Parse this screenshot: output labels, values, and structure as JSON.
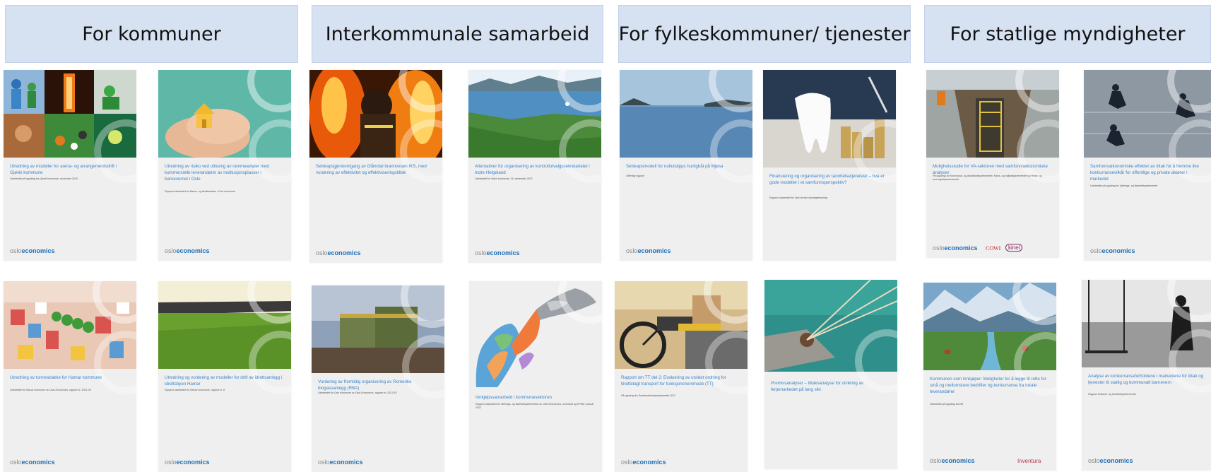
{
  "headers": [
    "For kommuner",
    "Interkommunale samarbeid",
    "For fylkeskommuner/ tjenester",
    "For statlige myndigheter"
  ],
  "logo": {
    "light": "oslo",
    "bold": "economics"
  },
  "cards": [
    {
      "title": "Utredning av modeller for arena- og arrangementsdrift i Gjøvik kommune",
      "subtitle": "Utarbeidet på oppdrag fra Gjøvik kommune, november 2020",
      "partners": []
    },
    {
      "title": "Utredning av risiko ved utfasing av rammeavtaler med kommersielle leverandører av institusjonsplasser i barnevernet i Oslo",
      "subtitle": "Rapport utarbeidet for Barne- og familieetaten i Oslo kommune",
      "partners": []
    },
    {
      "title": "Selskapsgjennomgang av Glåmdal brannvesen IKS, med vurdering av effektivitet og effektiviseringstiltak",
      "subtitle": "",
      "partners": []
    },
    {
      "title": "Alternativer for organisering av kontrollutvalgssekretariatet i Indre Helgeland",
      "subtitle": "Utarbeidet for Vefsn kommune, 26. desember 2022",
      "partners": []
    },
    {
      "title": "Selskapsmodell for nullutslipps hurtigbåt på Mjøsa",
      "subtitle": "Offentlig rapport",
      "partners": []
    },
    {
      "title": "Finansiering og organisering av tannhelsetjenester – hva er gode modeller i et samfunnsperspektiv?",
      "subtitle": "Rapport utarbeidet for Den norske tannlegeforening",
      "partners": []
    },
    {
      "title": "Mulighetsstudie for VA-sektoren med samfunnsøkonomiske analyser",
      "subtitle": "På oppdrag for Kommunal- og distriktsdepartementet, Klima- og miljødepartementet og Helse- og omsorgsdepartementet",
      "partners": [
        "COWI",
        "kinei"
      ]
    },
    {
      "title": "Samfunnsøkonomiske effekter av tiltak for å fremme like konkurransevilkår for offentlige og private aktører i markedet",
      "subtitle": "Utarbeidet på oppdrag for Nærings- og fiskeridepartementet",
      "partners": []
    },
    {
      "title": "Utredning av tonnesbakke for Hamar kommune",
      "subtitle": "Utarbeidet for Hamar kommune av Oslo Economics, rapport nr. 2021-35",
      "partners": []
    },
    {
      "title": "Utredning og vurdering av modeller for drift av idrettsanlegg i idrettsbyen Hamar",
      "subtitle": "Rapport utarbeidet for Hamar kommune, rapport nr. 8",
      "partners": []
    },
    {
      "title": "Vurdering av fremtidig organisering av Romerike biogassanlegg (RBA)",
      "subtitle": "Utarbeidet for Oslo kommune av Oslo Economics, rapport nr. 2021-83",
      "partners": []
    },
    {
      "title": "Innkjøpssamarbeid i kommunesektoren",
      "subtitle": "Rapport utarbeidet for Nærings- og fiskeridepartementet av Oslo Economics, Inventura og KPMG i januar 2022",
      "partners": []
    },
    {
      "title": "Rapport om TT del 2: Evaluering av utvidet ordning for tilrettelagt transport for funksjonshemmede (TT)",
      "subtitle": "På oppdrag for Samferdselsdepartementet 2022",
      "partners": []
    },
    {
      "title": "Premissanalyser – tiltaksanalyse for utvikling av ferjemarkedet på lang sikt",
      "subtitle": "",
      "partners": []
    },
    {
      "title": "Kommunen som innkjøper: Muligheter for å legge til rette for små og mellomstore bedrifter og konkurranse fra lokale leverandører",
      "subtitle": "Utarbeidet på oppdrag fra Difi",
      "partners": [
        "Inventura"
      ]
    },
    {
      "title": "Analyse av konkurranseforholdene i markedene for tiltak og tjenester til statlig og kommunalt barnevern",
      "subtitle": "Rapport til Barne- og familiedepartementet",
      "partners": []
    }
  ],
  "colors": {
    "header_bg": "#d6e1f2",
    "title_blue": "#3b83c9",
    "logo_blue": "#1f6fb8"
  }
}
